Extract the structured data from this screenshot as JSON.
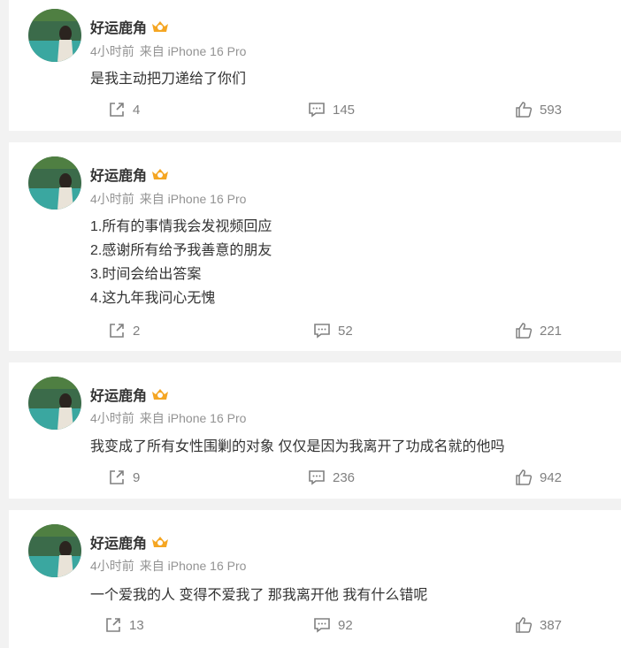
{
  "posts": [
    {
      "user": "好运鹿角",
      "time": "4小时前",
      "source": "来自 iPhone 16 Pro",
      "lines": [
        "是我主动把刀递给了你们"
      ],
      "share": "4",
      "comments": "145",
      "likes": "593"
    },
    {
      "user": "好运鹿角",
      "time": "4小时前",
      "source": "来自 iPhone 16 Pro",
      "lines": [
        "1.所有的事情我会发视频回应",
        "2.感谢所有给予我善意的朋友",
        "3.时间会给出答案",
        "4.这九年我问心无愧"
      ],
      "share": "2",
      "comments": "52",
      "likes": "221"
    },
    {
      "user": "好运鹿角",
      "time": "4小时前",
      "source": "来自 iPhone 16 Pro",
      "lines": [
        "我变成了所有女性围剿的对象 仅仅是因为我离开了功成名就的他吗"
      ],
      "share": "9",
      "comments": "236",
      "likes": "942"
    },
    {
      "user": "好运鹿角",
      "time": "4小时前",
      "source": "来自 iPhone 16 Pro",
      "lines": [
        "一个爱我的人 变得不爱我了 那我离开他 我有什么错呢"
      ],
      "share": "13",
      "comments": "92",
      "likes": "387"
    }
  ],
  "colors": {
    "vip_badge": "#f5a623",
    "meta": "#939393",
    "action": "#808080"
  },
  "icons": {
    "share": "share-icon",
    "comment": "comment-icon",
    "like": "like-icon",
    "badge": "vip-crown-icon"
  }
}
